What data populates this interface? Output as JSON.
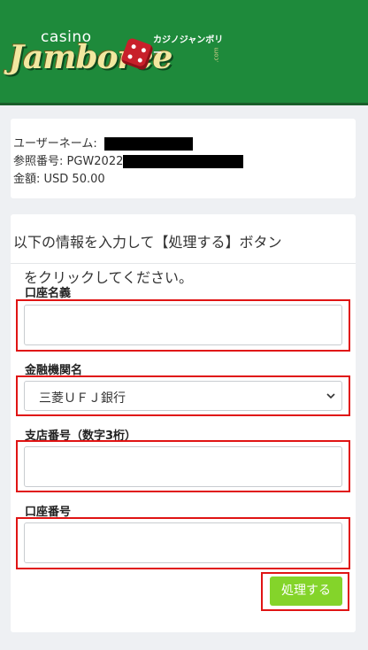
{
  "header": {
    "logo_small": "casino",
    "logo_main": "Jamboree",
    "logo_kana": "カジノジャンボリー",
    "logo_com": ".com",
    "bg_color": "#1e8a3b"
  },
  "info": {
    "username_label": "ユーザーネーム:",
    "ref_label": "参照番号: PGW2022",
    "amount": "金額: USD 50.00"
  },
  "form": {
    "instruction_line1": "以下の情報を入力して【処理する】ボタン",
    "instruction_line2": "をクリックしてください。",
    "account_name_label": "口座名義",
    "account_name_value": "",
    "bank_label": "金融機関名",
    "bank_selected": "三菱ＵＦＪ銀行",
    "branch_label": "支店番号（数字3桁）",
    "branch_value": "",
    "account_number_label": "口座番号",
    "account_number_value": "",
    "submit_label": "処理する"
  },
  "colors": {
    "highlight": "#e01414",
    "submit": "#84d42a"
  }
}
